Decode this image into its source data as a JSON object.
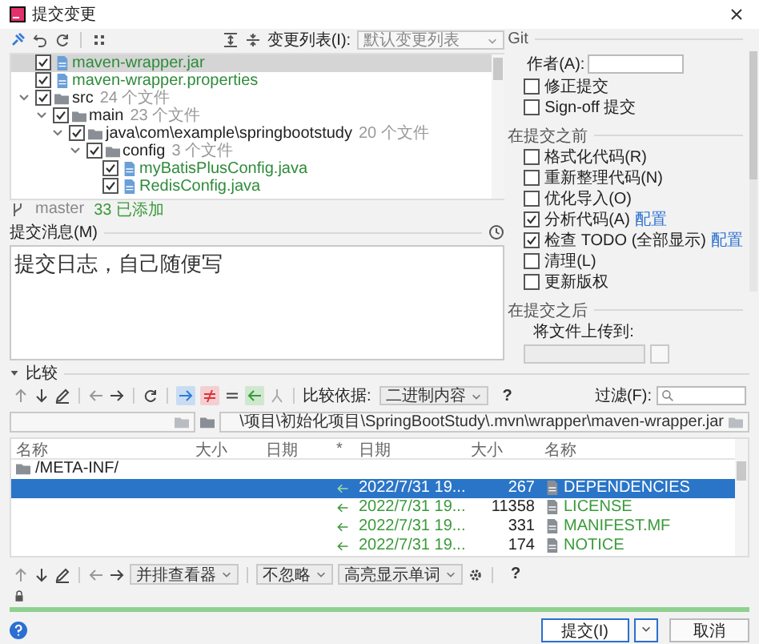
{
  "window": {
    "title": "提交变更"
  },
  "toolbar": {
    "changelist_label": "变更列表(I):",
    "changelist_value": "默认变更列表"
  },
  "tree": [
    {
      "kind": "file",
      "name": "maven-wrapper.jar",
      "checked": true,
      "selected": true
    },
    {
      "kind": "file",
      "name": "maven-wrapper.properties",
      "checked": true,
      "selected": false
    },
    {
      "kind": "folder",
      "name": "src",
      "count": "24 个文件",
      "checked": true,
      "selected": false,
      "expanded": true,
      "children": [
        {
          "kind": "folder",
          "name": "main",
          "count": "23 个文件",
          "checked": true,
          "selected": false,
          "expanded": true,
          "children": [
            {
              "kind": "folder",
              "name": "java\\com\\example\\springbootstudy",
              "count": "20 个文件",
              "checked": true,
              "selected": false,
              "expanded": true,
              "children": [
                {
                  "kind": "folder",
                  "name": "config",
                  "count": "3 个文件",
                  "checked": true,
                  "selected": false,
                  "expanded": true,
                  "children": [
                    {
                      "kind": "file",
                      "name": "myBatisPlusConfig.java",
                      "checked": true,
                      "selected": false
                    },
                    {
                      "kind": "file",
                      "name": "RedisConfig.java",
                      "checked": true,
                      "selected": false
                    }
                  ]
                }
              ]
            }
          ]
        }
      ]
    }
  ],
  "status": {
    "branch": "master",
    "added": "33 已添加"
  },
  "message": {
    "label": "提交消息(M)",
    "value": "提交日志，自己随便写"
  },
  "git": {
    "title": "Git",
    "author_label": "作者(A):",
    "options": [
      {
        "label": "修正提交",
        "checked": false
      },
      {
        "label": "Sign-off 提交",
        "checked": false
      }
    ]
  },
  "before_commit": {
    "title": "在提交之前",
    "options": [
      {
        "label": "格式化代码(R)",
        "checked": false
      },
      {
        "label": "重新整理代码(N)",
        "checked": false
      },
      {
        "label": "优化导入(O)",
        "checked": false
      },
      {
        "label": "分析代码(A)",
        "checked": true,
        "link": "配置"
      },
      {
        "label": "检查 TODO (全部显示)",
        "checked": true,
        "link": "配置"
      },
      {
        "label": "清理(L)",
        "checked": false
      },
      {
        "label": "更新版权",
        "checked": false
      }
    ]
  },
  "after_commit": {
    "title": "在提交之后",
    "upload_label": "将文件上传到:"
  },
  "compare": {
    "title": "比较",
    "expanded": true,
    "compare_by_label": "比较依据:",
    "compare_by_value": "二进制内容",
    "help": "?",
    "filter_label": "过滤(F):",
    "right_path": "\\项目\\初始化项目\\SpringBootStudy\\.mvn\\wrapper\\maven-wrapper.jar",
    "columns": [
      "名称",
      "大小",
      "日期",
      "*",
      "日期",
      "大小",
      "名称"
    ],
    "rows": [
      {
        "kind": "folder",
        "left_name": "/META-INF/",
        "selected": false
      },
      {
        "kind": "file",
        "date": "2022/7/31 19...",
        "size": "267",
        "name": "DEPENDENCIES",
        "selected": true
      },
      {
        "kind": "file",
        "date": "2022/7/31 19...",
        "size": "11358",
        "name": "LICENSE",
        "selected": false
      },
      {
        "kind": "file",
        "date": "2022/7/31 19...",
        "size": "331",
        "name": "MANIFEST.MF",
        "selected": false
      },
      {
        "kind": "file",
        "date": "2022/7/31 19...",
        "size": "174",
        "name": "NOTICE",
        "selected": false
      }
    ],
    "viewer": "并排查看器",
    "ignore": "不忽略",
    "highlight": "高亮显示单词",
    "help2": "?"
  },
  "progress": {
    "level": 1
  },
  "buttons": {
    "commit": "提交(I)",
    "cancel": "取消"
  }
}
